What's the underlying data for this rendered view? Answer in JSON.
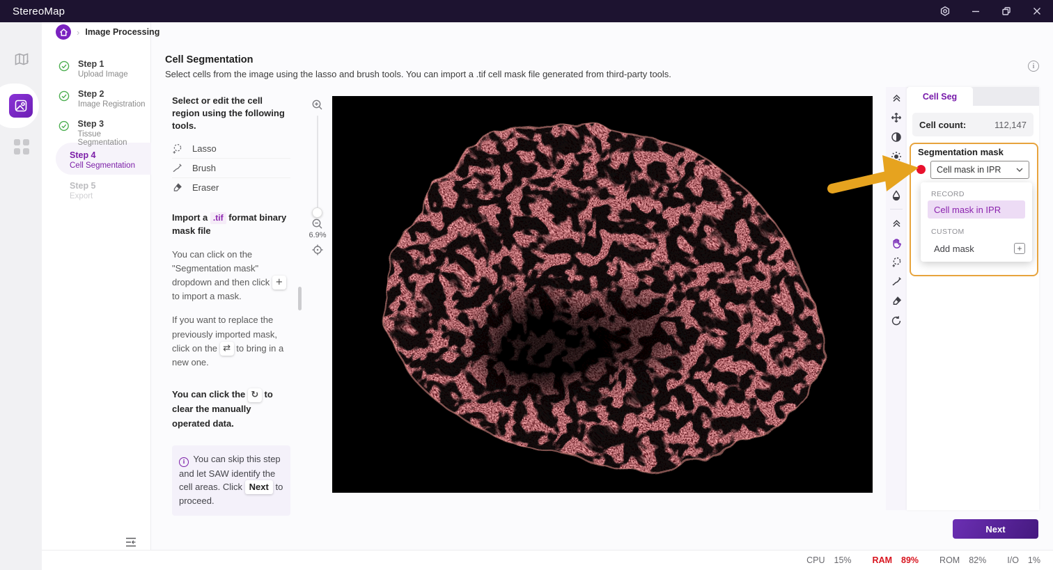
{
  "titlebar": {
    "app_title": "StereoMap",
    "icons": {
      "settings": "gear-icon",
      "minimize": "minimize-icon",
      "maximize": "restore-icon",
      "close": "close-icon"
    }
  },
  "breadcrumb": {
    "separator": "›",
    "current": "Image Processing",
    "home_icon": "home-icon"
  },
  "rail": {
    "items": [
      {
        "name": "map",
        "icon": "map-icon",
        "active": false
      },
      {
        "name": "image-processing",
        "icon": "image-icon",
        "active": true
      },
      {
        "name": "apps",
        "icon": "apps-grid-icon",
        "active": false
      }
    ]
  },
  "steps": [
    {
      "label": "Step 1",
      "sublabel": "Upload Image",
      "status": "done"
    },
    {
      "label": "Step 2",
      "sublabel": "Image Registration",
      "status": "done"
    },
    {
      "label": "Step 3",
      "sublabel": "Tissue Segmentation",
      "status": "done"
    },
    {
      "label": "Step 4",
      "sublabel": "Cell Segmentation",
      "status": "active"
    },
    {
      "label": "Step 5",
      "sublabel": "Export",
      "status": "disabled"
    }
  ],
  "page": {
    "title": "Cell Segmentation",
    "description": "Select cells from the image using the lasso and brush tools. You can import a .tif cell mask file generated from third-party tools."
  },
  "tools_panel": {
    "heading": "Select or edit the cell region using the following tools.",
    "tools": [
      {
        "label": "Lasso",
        "icon": "lasso-icon"
      },
      {
        "label": "Brush",
        "icon": "brush-icon"
      },
      {
        "label": "Eraser",
        "icon": "eraser-icon"
      }
    ],
    "import_heading_pre": "Import a",
    "import_badge": ".tif",
    "import_heading_post": "format binary mask file",
    "p1_pre": "You can click on the \"Segmentation mask\" dropdown and then click",
    "p1_chip": "+",
    "p1_post": "to import a mask.",
    "p2_pre": "If you want to replace the previously imported mask, click on the",
    "p2_chip": "⇄",
    "p2_post": "to bring in a new one.",
    "p3_pre": "You can click the",
    "p3_chip": "↻",
    "p3_post": "to clear the manually operated data.",
    "note_pre": "You can skip this step and let SAW identify the cell areas. Click",
    "note_chip": "Next",
    "note_post": "to proceed."
  },
  "zoom_controls": {
    "level": "6.9%",
    "icons": [
      "zoom-in-icon",
      "zoom-out-icon",
      "fit-view-icon"
    ]
  },
  "right_toolbar": {
    "icons": [
      "collapse-up-icon",
      "adjust-move-icon",
      "contrast-icon",
      "brightness-icon",
      "levels-grid-icon",
      "saturation-drop-icon",
      "collapse-up-icon",
      "pan-hand-icon",
      "lasso-icon",
      "brush-icon",
      "eraser-icon",
      "reset-rotate-icon"
    ],
    "active_tool": "pan-hand-icon"
  },
  "right_panel": {
    "tab": "Cell Seg",
    "cell_count_label": "Cell count:",
    "cell_count_value": "112,147",
    "section_label": "Segmentation mask",
    "dropdown_value": "Cell mask in IPR",
    "menu": {
      "record_caption": "RECORD",
      "record_item": "Cell mask in IPR",
      "custom_caption": "CUSTOM",
      "add_item": "Add mask",
      "add_icon": "+"
    }
  },
  "footer": {
    "next_label": "Next",
    "stats": [
      {
        "label": "CPU",
        "value": "15%"
      },
      {
        "label": "RAM",
        "value": "89%",
        "alert": true
      },
      {
        "label": "ROM",
        "value": "82%"
      },
      {
        "label": "I/O",
        "value": "1%"
      }
    ]
  },
  "colors": {
    "accent_purple": "#7b22c0",
    "callout_orange": "#e7a33c",
    "arrow_gold": "#e6a31f",
    "alert_red": "#d8141e",
    "mask_dot_red": "#e8112d",
    "canvas_bg": "#000000",
    "tissue_red": "#d4525b"
  }
}
